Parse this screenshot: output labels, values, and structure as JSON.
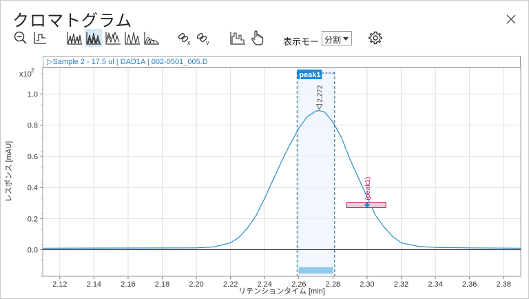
{
  "window": {
    "title": "クロマトグラム"
  },
  "toolbar": {
    "buttons": [
      {
        "name": "zoom-out",
        "icon": "zoom-out-icon"
      },
      {
        "name": "baseline",
        "icon": "baseline-icon"
      },
      {
        "name": "overlay-peaks",
        "icon": "peaks-overlay-icon"
      },
      {
        "name": "stacked-peaks",
        "icon": "peaks-stacked-icon"
      },
      {
        "name": "offset-peaks",
        "icon": "peaks-offset-icon"
      },
      {
        "name": "separate-peaks",
        "icon": "peaks-separate-icon"
      },
      {
        "name": "layered-peaks",
        "icon": "peaks-layered-icon"
      },
      {
        "name": "unlink-x",
        "icon": "unlink-x-icon"
      },
      {
        "name": "unlink-y",
        "icon": "unlink-y-icon"
      },
      {
        "name": "integration",
        "icon": "integration-icon"
      },
      {
        "name": "pan",
        "icon": "hand-pointer-icon"
      },
      {
        "name": "settings",
        "icon": "gear-icon"
      }
    ],
    "display_mode_label": "表示モード",
    "display_mode_value": "分割"
  },
  "plot": {
    "header": "▷Sample 2 - 17.5 ul | DAD1A | 002-0501_005.D"
  },
  "chart_data": {
    "type": "line",
    "xlabel": "リテンションタイム [min]",
    "ylabel": "レスポンス [mAU]",
    "y_multiplier": "x10",
    "y_multiplier_exp": "2",
    "xlim": [
      2.11,
      2.39
    ],
    "ylim": [
      -0.17,
      1.17
    ],
    "x_ticks": [
      "2.12",
      "2.14",
      "2.16",
      "2.18",
      "2.20",
      "2.22",
      "2.24",
      "2.26",
      "2.28",
      "2.30",
      "2.32",
      "2.34",
      "2.36",
      "2.38"
    ],
    "y_ticks": [
      "0.0",
      "0.2",
      "0.4",
      "0.6",
      "0.8",
      "1.0"
    ],
    "grid": true,
    "series": [
      {
        "color": "#2a8ac9",
        "x": [
          2.11,
          2.2,
          2.21,
          2.22,
          2.225,
          2.23,
          2.235,
          2.24,
          2.245,
          2.25,
          2.255,
          2.26,
          2.265,
          2.27,
          2.272,
          2.275,
          2.28,
          2.285,
          2.29,
          2.295,
          2.3,
          2.305,
          2.31,
          2.315,
          2.32,
          2.33,
          2.34,
          2.36,
          2.39
        ],
        "y": [
          0.01,
          0.012,
          0.018,
          0.045,
          0.08,
          0.14,
          0.22,
          0.33,
          0.45,
          0.57,
          0.68,
          0.78,
          0.855,
          0.89,
          0.893,
          0.885,
          0.82,
          0.72,
          0.58,
          0.46,
          0.34,
          0.22,
          0.145,
          0.085,
          0.045,
          0.022,
          0.015,
          0.012,
          0.01
        ]
      }
    ],
    "baseline_y": 0.0,
    "peak": {
      "label": "peak1",
      "apex_label": "2.272",
      "apex_x": 2.272,
      "apex_y": 0.893,
      "start_x": 2.259,
      "end_x": 2.281,
      "window_x": [
        2.26,
        2.28
      ],
      "marker_label": "(peak1)",
      "marker_x": 2.3,
      "marker_y": 0.287,
      "marker_box_x": [
        2.288,
        2.311
      ],
      "marker_box_y": [
        0.27,
        0.305
      ]
    }
  }
}
